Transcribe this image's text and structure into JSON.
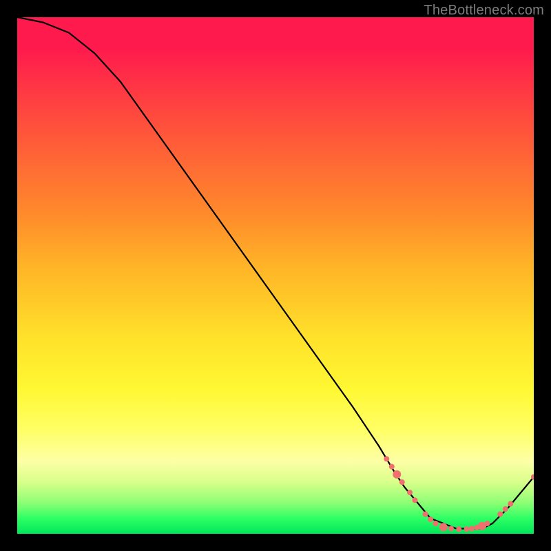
{
  "watermark": "TheBottleneck.com",
  "chart_data": {
    "type": "line",
    "title": "",
    "xlabel": "",
    "ylabel": "",
    "xlim": [
      0,
      100
    ],
    "ylim": [
      0,
      100
    ],
    "grid": false,
    "legend": false,
    "background": "red-yellow-green vertical gradient",
    "curve_color": "#000000",
    "marker_color": "#f07070",
    "series": [
      {
        "name": "bottleneck-curve",
        "x": [
          0,
          5,
          10,
          15,
          20,
          25,
          30,
          35,
          40,
          45,
          50,
          55,
          60,
          65,
          70,
          73,
          75,
          80,
          85,
          90,
          92,
          95,
          100
        ],
        "y": [
          100,
          99,
          97,
          93,
          87.5,
          80.5,
          73.5,
          66.5,
          59.5,
          52.5,
          45.5,
          38.5,
          31.5,
          24.5,
          17,
          12,
          9,
          3,
          1,
          1,
          2,
          5,
          11
        ]
      }
    ],
    "markers": [
      {
        "x": 71.5,
        "y": 14.5,
        "r": 4
      },
      {
        "x": 72.5,
        "y": 13.0,
        "r": 4
      },
      {
        "x": 73.5,
        "y": 11.5,
        "r": 6
      },
      {
        "x": 74.5,
        "y": 10.0,
        "r": 4
      },
      {
        "x": 76.0,
        "y": 8.0,
        "r": 4
      },
      {
        "x": 77.0,
        "y": 6.5,
        "r": 4
      },
      {
        "x": 79.0,
        "y": 3.8,
        "r": 4
      },
      {
        "x": 80.0,
        "y": 2.8,
        "r": 4
      },
      {
        "x": 81.0,
        "y": 2.0,
        "r": 4
      },
      {
        "x": 82.5,
        "y": 1.3,
        "r": 6
      },
      {
        "x": 84.0,
        "y": 1.0,
        "r": 4
      },
      {
        "x": 85.5,
        "y": 0.9,
        "r": 4
      },
      {
        "x": 87.0,
        "y": 0.9,
        "r": 4
      },
      {
        "x": 88.0,
        "y": 1.0,
        "r": 4
      },
      {
        "x": 89.0,
        "y": 1.2,
        "r": 4
      },
      {
        "x": 90.0,
        "y": 1.5,
        "r": 6
      },
      {
        "x": 91.0,
        "y": 2.0,
        "r": 4
      },
      {
        "x": 93.5,
        "y": 3.8,
        "r": 4
      },
      {
        "x": 94.5,
        "y": 4.8,
        "r": 4
      },
      {
        "x": 95.5,
        "y": 5.8,
        "r": 4
      },
      {
        "x": 100.0,
        "y": 11.0,
        "r": 4
      }
    ]
  }
}
